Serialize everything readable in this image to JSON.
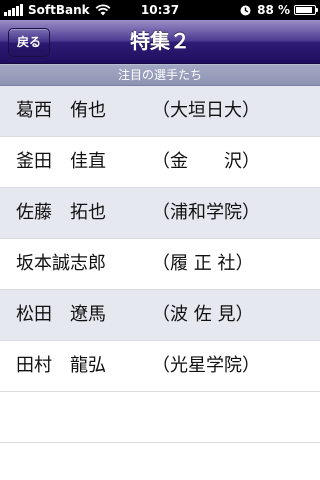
{
  "status_bar": {
    "carrier": "SoftBank",
    "time": "10:37",
    "battery_percent": "88 %",
    "battery_level": 0.88,
    "icons": [
      "signal-icon",
      "wifi-icon",
      "lock-icon",
      "battery-icon"
    ]
  },
  "nav": {
    "back_label": "戻る",
    "title": "特集２"
  },
  "section": {
    "header": "注目の選手たち"
  },
  "players": [
    {
      "name": "葛西　侑也",
      "school": "（大垣日大）"
    },
    {
      "name": "釜田　佳直",
      "school": "（金　　沢）"
    },
    {
      "name": "佐藤　拓也",
      "school": "（浦和学院）"
    },
    {
      "name": "坂本誠志郎",
      "school": "（履 正 社）"
    },
    {
      "name": "松田　遼馬",
      "school": "（波 佐 見）"
    },
    {
      "name": "田村　龍弘",
      "school": "（光星学院）"
    }
  ],
  "colors": {
    "nav_bar": "#2f1c76",
    "section_header": "#8d93b2",
    "row_shade": "#e6e8f0"
  }
}
